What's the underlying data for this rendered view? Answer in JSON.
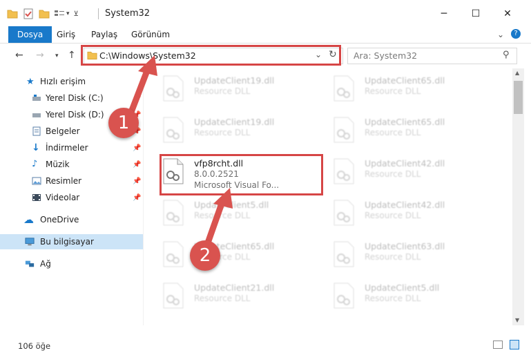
{
  "window": {
    "title": "System32"
  },
  "ribbon": {
    "tabs": [
      {
        "label": "Dosya"
      },
      {
        "label": "Giriş"
      },
      {
        "label": "Paylaş"
      },
      {
        "label": "Görünüm"
      }
    ]
  },
  "address": {
    "path": "C:\\Windows\\System32"
  },
  "search": {
    "placeholder": "Ara: System32"
  },
  "sidebar": {
    "items": [
      {
        "label": "Hızlı erişim"
      },
      {
        "label": "Yerel Disk (C:)"
      },
      {
        "label": "Yerel Disk (D:)"
      },
      {
        "label": "Belgeler"
      },
      {
        "label": "İndirmeler"
      },
      {
        "label": "Müzik"
      },
      {
        "label": "Resimler"
      },
      {
        "label": "Videolar"
      },
      {
        "label": "OneDrive"
      },
      {
        "label": "Bu bilgisayar"
      },
      {
        "label": "Ağ"
      }
    ]
  },
  "files": [
    {
      "name": "UpdateClient19.dll",
      "line1": "Resource DLL",
      "line2": ""
    },
    {
      "name": "UpdateClient65.dll",
      "line1": "Resource DLL",
      "line2": ""
    },
    {
      "name": "UpdateClient19.dll",
      "line1": "Resource DLL",
      "line2": ""
    },
    {
      "name": "UpdateClient65.dll",
      "line1": "Resource DLL",
      "line2": ""
    },
    {
      "name": "vfp8rcht.dll",
      "line1": "8.0.0.2521",
      "line2": "Microsoft Visual Fo..."
    },
    {
      "name": "UpdateClient42.dll",
      "line1": "Resource DLL",
      "line2": ""
    },
    {
      "name": "UpdateClient5.dll",
      "line1": "Resource DLL",
      "line2": ""
    },
    {
      "name": "UpdateClient42.dll",
      "line1": "Resource DLL",
      "line2": ""
    },
    {
      "name": "UpdateClient65.dll",
      "line1": "Resource DLL",
      "line2": ""
    },
    {
      "name": "UpdateClient63.dll",
      "line1": "Resource DLL",
      "line2": ""
    },
    {
      "name": "UpdateClient21.dll",
      "line1": "Resource DLL",
      "line2": ""
    },
    {
      "name": "UpdateClient5.dll",
      "line1": "Resource DLL",
      "line2": ""
    }
  ],
  "status": {
    "count": "106 öğe"
  },
  "annotations": {
    "step1": "1",
    "step2": "2"
  },
  "colors": {
    "accent": "#1979ca",
    "highlight": "#d64545"
  }
}
